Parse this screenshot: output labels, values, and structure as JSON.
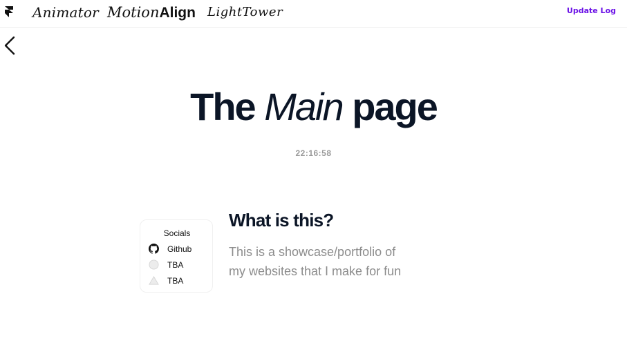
{
  "nav": {
    "links": [
      "Animator",
      "Motion",
      "Align",
      "LightTower"
    ],
    "update_log": "Update Log"
  },
  "hero": {
    "title_part1": "The",
    "title_part2": "Main",
    "title_part3": "page",
    "clock": "22:16:58"
  },
  "socials": {
    "title": "Socials",
    "items": [
      {
        "label": "Github",
        "icon": "github-icon"
      },
      {
        "label": "TBA",
        "icon": "circle-icon"
      },
      {
        "label": "TBA",
        "icon": "triangle-icon"
      }
    ]
  },
  "about": {
    "heading": "What is this?",
    "text": "This is a showcase/portfolio of my websites that I make for fun"
  },
  "colors": {
    "accent": "#6a10e6",
    "heading": "#0b1526",
    "muted": "#8c8c8c"
  }
}
